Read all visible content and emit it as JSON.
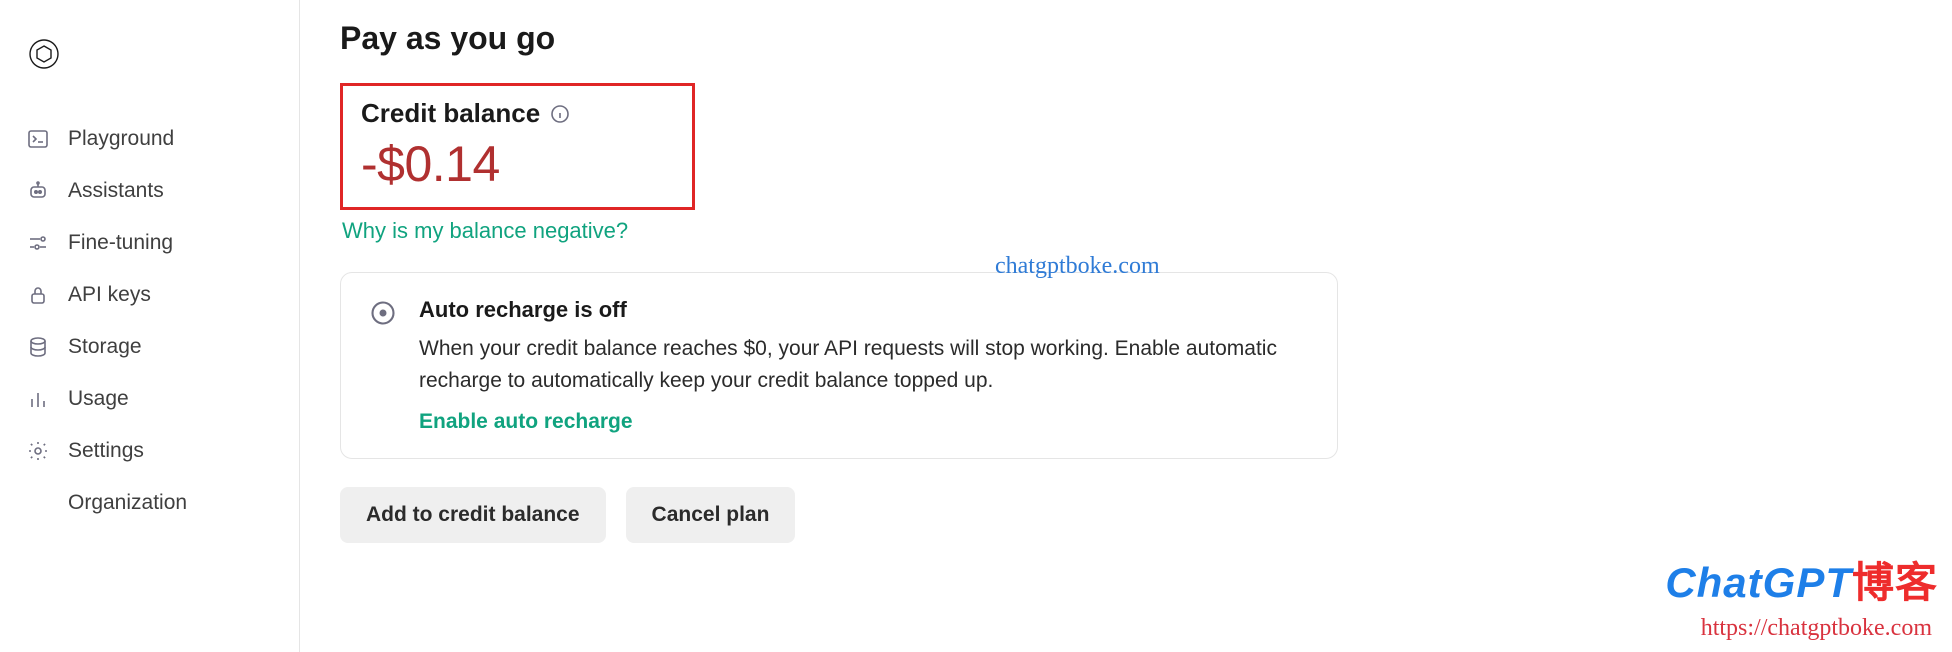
{
  "sidebar": {
    "items": [
      {
        "label": "Playground",
        "icon": "terminal-icon"
      },
      {
        "label": "Assistants",
        "icon": "robot-icon"
      },
      {
        "label": "Fine-tuning",
        "icon": "sliders-icon"
      },
      {
        "label": "API keys",
        "icon": "lock-icon"
      },
      {
        "label": "Storage",
        "icon": "database-icon"
      },
      {
        "label": "Usage",
        "icon": "chart-icon"
      },
      {
        "label": "Settings",
        "icon": "gear-icon"
      }
    ],
    "subitem": "Organization"
  },
  "page": {
    "title": "Pay as you go",
    "balance_label": "Credit balance",
    "balance_amount": "-$0.14",
    "negative_link": "Why is my balance negative?"
  },
  "card": {
    "title": "Auto recharge is off",
    "description": "When your credit balance reaches $0, your API requests will stop working. Enable automatic recharge to automatically keep your credit balance topped up.",
    "link": "Enable auto recharge"
  },
  "buttons": {
    "add": "Add to credit balance",
    "cancel": "Cancel plan"
  },
  "watermark": {
    "center": "chatgptboke.com",
    "logo_part1": "ChatGPT",
    "logo_part2": "博客",
    "url": "https://chatgptboke.com"
  }
}
